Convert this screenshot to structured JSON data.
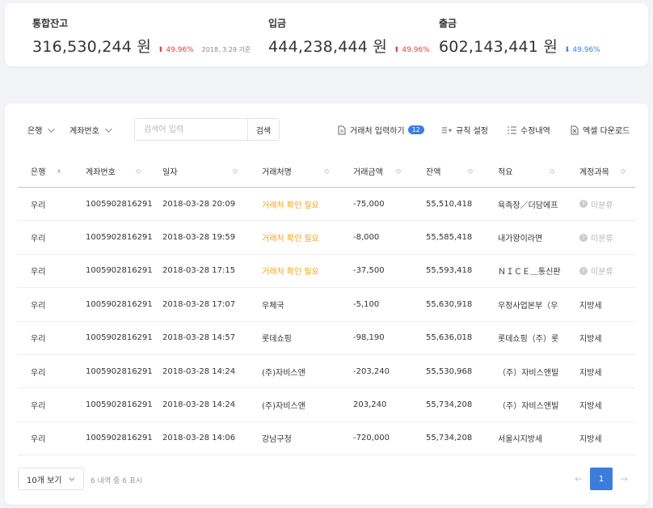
{
  "summary": {
    "balance": {
      "label": "통합잔고",
      "amount": "316,530,244 원",
      "change": "⬆ 49.96%",
      "as_of": "2018. 3.29 기준"
    },
    "deposit": {
      "label": "입금",
      "amount": "444,238,444 원",
      "change": "⬆ 49.96%"
    },
    "withdraw": {
      "label": "출금",
      "amount": "602,143,441 원",
      "change": "⬇ 49.96%"
    }
  },
  "toolbar": {
    "bank_filter": "은행",
    "account_filter": "계좌번호",
    "search_placeholder": "검색어 입력",
    "search_button": "검색",
    "input_counterparty": "거래처 입력하기",
    "input_badge": "12",
    "rule_settings": "규칙 설정",
    "edit_history": "수정내역",
    "excel_download": "엑셀 다운로드"
  },
  "table": {
    "headers": [
      "은행",
      "계좌번호",
      "일자",
      "거래처명",
      "거래금액",
      "잔액",
      "적요",
      "계정과목"
    ],
    "rows": [
      [
        "우리",
        "1005902816291",
        "2018-03-28 20:09",
        "거래처 확인 필요",
        "-75,000",
        "55,510,418",
        "육족장／더담에프",
        "미분류"
      ],
      [
        "우리",
        "1005902816291",
        "2018-03-28 19:59",
        "거래처 확인 필요",
        "-8,000",
        "55,585,418",
        "내가왕이라면",
        "미분류"
      ],
      [
        "우리",
        "1005902816291",
        "2018-03-28 17:15",
        "거래처 확인 필요",
        "-37,500",
        "55,593,418",
        "ＮＩＣＥ＿통신판",
        "미분류"
      ],
      [
        "우리",
        "1005902816291",
        "2018-03-28 17:07",
        "우체국",
        "-5,100",
        "55,630,918",
        "우정사업본부（우",
        "지방세"
      ],
      [
        "우리",
        "1005902816291",
        "2018-03-28 14:57",
        "롯데쇼핑",
        "-98,190",
        "55,636,018",
        "롯데쇼핑（주）롯",
        "지방세"
      ],
      [
        "우리",
        "1005902816291",
        "2018-03-28 14:24",
        "(주)자비스앤",
        "-203,240",
        "55,530,968",
        "（주）자비스앤빌",
        "지방세"
      ],
      [
        "우리",
        "1005902816291",
        "2018-03-28 14:24",
        "(주)자비스앤",
        "203,240",
        "55,734,208",
        "（주）자비스앤빌",
        "지방세"
      ],
      [
        "우리",
        "1005902816291",
        "2018-03-28 14:06",
        "강남구청",
        "-720,000",
        "55,734,208",
        "서울시지방세",
        "지방세"
      ]
    ]
  },
  "footer": {
    "page_size": "10개 보기",
    "page_info": "6 내역 중 6 표시",
    "current_page": "1"
  },
  "colors": {
    "accent": "#3b7ddd",
    "up": "#e53e3e",
    "down": "#3b82f6",
    "warning": "#f5a623"
  }
}
